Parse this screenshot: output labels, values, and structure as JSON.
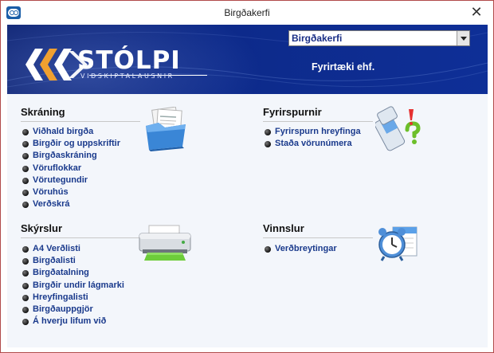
{
  "window": {
    "title": "Birgðakerfi"
  },
  "banner": {
    "logo_name": "STÓLPI",
    "logo_tagline": "VIÐSKIPTALAUSNIR",
    "module_select": {
      "value": "Birgðakerfi"
    },
    "company": "Fyrirtæki ehf."
  },
  "sections": {
    "skraning": {
      "title": "Skráning",
      "icon": "folder-documents-icon",
      "items": [
        "Viðhald birgða",
        "Birgðir og uppskriftir",
        "Birgðaskráning",
        "Vöruflokkar",
        "Vörutegundir",
        "Vöruhús",
        "Verðskrá"
      ]
    },
    "fyrirspurnir": {
      "title": "Fyrirspurnir",
      "icon": "phone-question-icon",
      "items": [
        "Fyrirspurn hreyfinga",
        "Staða vörunúmera"
      ]
    },
    "skyrslur": {
      "title": "Skýrslur",
      "icon": "printer-icon",
      "items": [
        "A4 Verðlisti",
        "Birgðalisti",
        "Birgðatalning",
        "Birgðir undir lágmarki",
        "Hreyfingalisti",
        "Birgðauppgjör",
        "Á hverju lifum við"
      ]
    },
    "vinnslur": {
      "title": "Vinnslur",
      "icon": "alarm-clock-calendar-icon",
      "items": [
        "Verðbreytingar"
      ]
    }
  },
  "colors": {
    "banner": "#0d2a8a",
    "link": "#1a3a8c",
    "content_bg": "#f3f6fb",
    "accent_orange": "#e8891c"
  }
}
